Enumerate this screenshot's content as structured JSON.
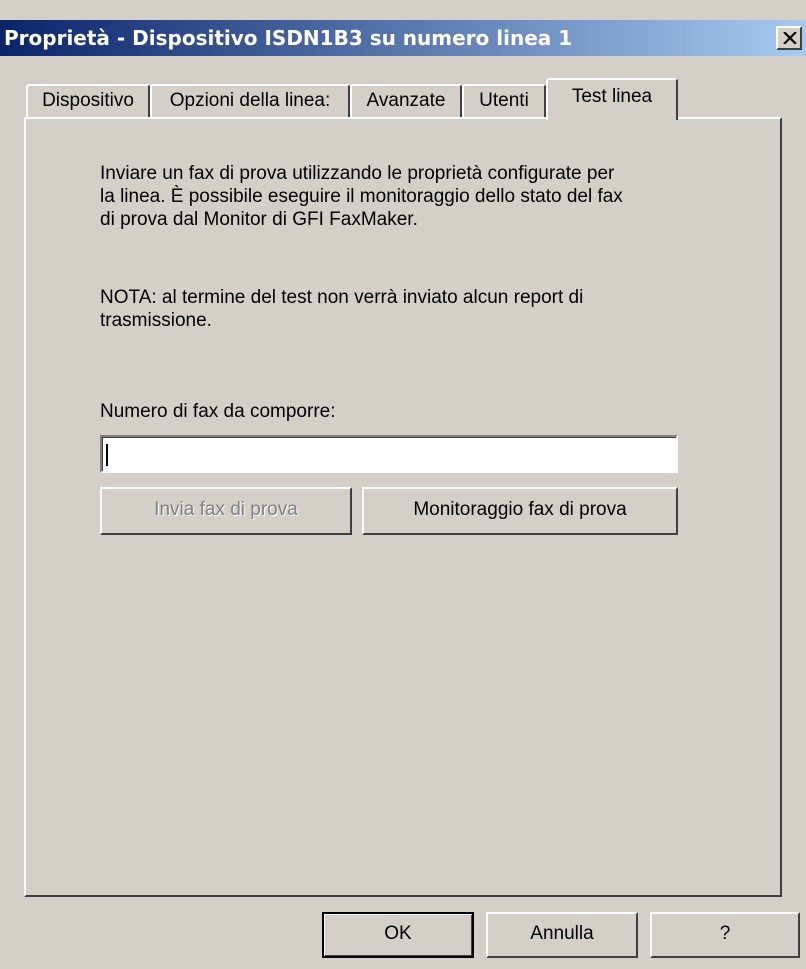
{
  "window": {
    "title": "Proprietà - Dispositivo ISDN1B3 su numero linea 1"
  },
  "tabs": [
    {
      "label": "Dispositivo"
    },
    {
      "label": "Opzioni della linea:"
    },
    {
      "label": "Avanzate"
    },
    {
      "label": "Utenti"
    },
    {
      "label": "Test linea",
      "active": true
    }
  ],
  "panel": {
    "intro_lines": [
      "Inviare un fax di prova utilizzando le proprietà configurate per",
      "la linea. È possibile eseguire il monitoraggio dello stato del fax",
      "di prova dal Monitor di GFI FaxMaker."
    ],
    "note_lines": [
      "NOTA: al termine del test non verrà inviato alcun report di",
      "trasmissione."
    ],
    "fax_number_label": "Numero di fax da comporre:",
    "fax_number_value": "",
    "send_test_button": "Invia fax di prova",
    "monitor_test_button": "Monitoraggio fax di prova"
  },
  "footer": {
    "ok_label": "OK",
    "cancel_label": "Annulla",
    "help_label": "?"
  }
}
